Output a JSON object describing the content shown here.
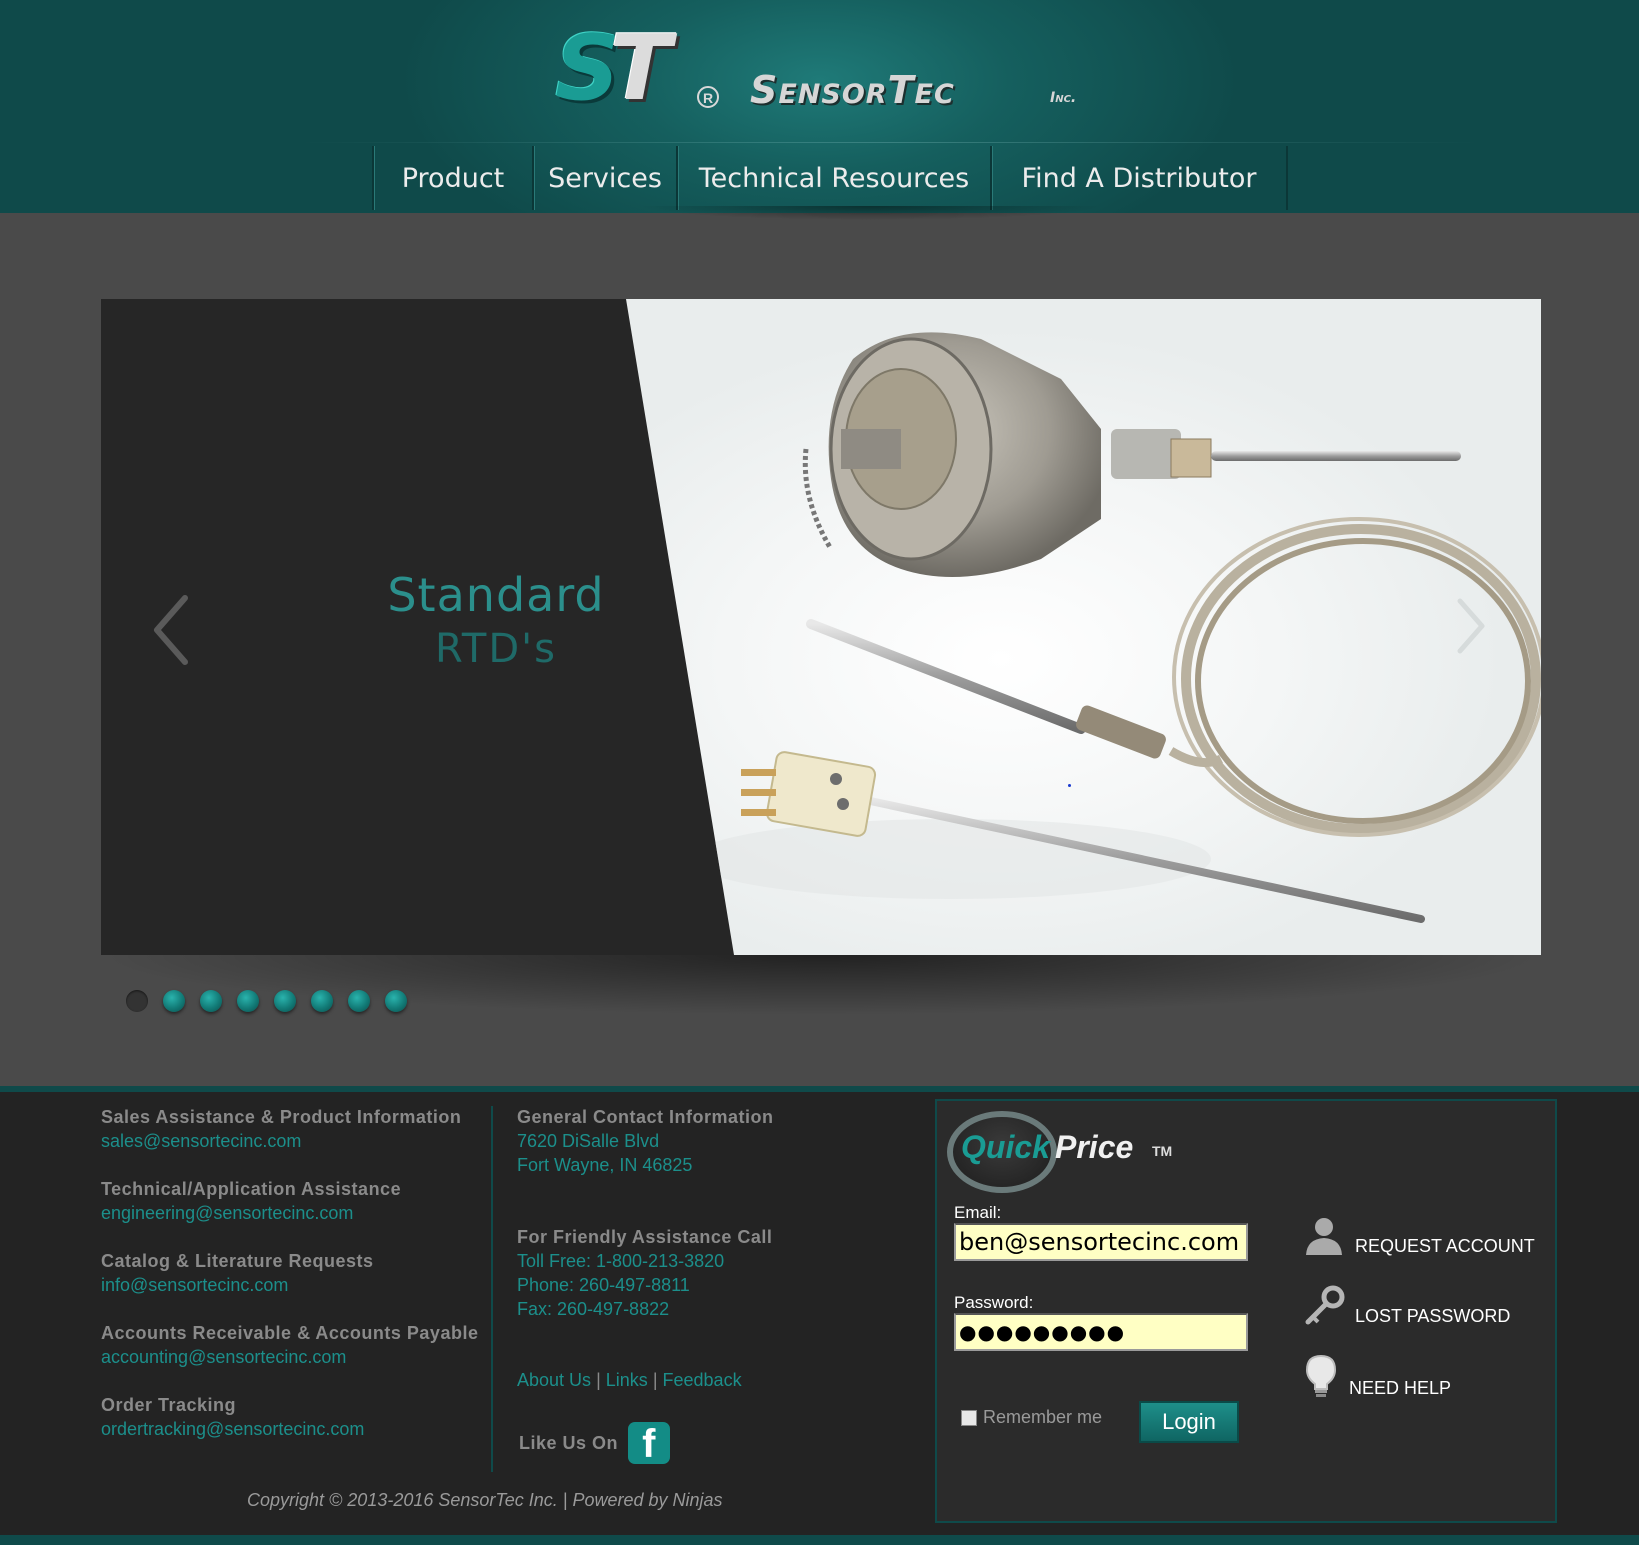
{
  "brand": {
    "logo_mark_s": "S",
    "logo_mark_t": "T",
    "logo_registered": "R",
    "company_name": "SensorTec",
    "company_suffix": "Inc."
  },
  "nav": {
    "items": [
      {
        "label": "Product"
      },
      {
        "label": "Services"
      },
      {
        "label": "Technical Resources"
      },
      {
        "label": "Find A Distributor"
      }
    ]
  },
  "slider": {
    "title": "Standard",
    "subtitle": "RTD's",
    "prev_icon": "chevron-left-icon",
    "next_icon": "chevron-right-icon",
    "slide_count": 8,
    "active_index": 0
  },
  "contact": {
    "groups": [
      {
        "label": "Sales Assistance & Product Information",
        "value": "sales@sensortecinc.com"
      },
      {
        "label": "Technical/Application Assistance",
        "value": "engineering@sensortecinc.com"
      },
      {
        "label": "Catalog & Literature Requests",
        "value": "info@sensortecinc.com"
      },
      {
        "label": "Accounts Receivable & Accounts Payable",
        "value": "accounting@sensortecinc.com"
      },
      {
        "label": "Order Tracking",
        "value": "ordertracking@sensortecinc.com"
      }
    ],
    "general": {
      "label": "General Contact Information",
      "address_line1": "7620 DiSalle Blvd",
      "address_line2": "Fort Wayne, IN 46825"
    },
    "phone": {
      "label": "For Friendly Assistance Call",
      "toll_free": "Toll Free: 1-800-213-3820",
      "phone": "Phone: 260-497-8811",
      "fax": "Fax: 260-497-8822"
    },
    "links": {
      "about": "About Us",
      "links": "Links",
      "feedback": "Feedback",
      "separator": "|"
    },
    "like_us": "Like Us On",
    "facebook_icon": "facebook-icon",
    "facebook_letter": "f"
  },
  "copyright": "Copyright © 2013-2016 SensorTec Inc. | Powered by Ninjas",
  "quickprice": {
    "logo_quick": "Quick",
    "logo_price": "Price",
    "logo_tm": "TM",
    "email_label": "Email:",
    "email_value": "ben@sensortecinc.com",
    "password_label": "Password:",
    "password_value": "●●●●●●●●●",
    "remember_label": "Remember me",
    "login_label": "Login",
    "actions": [
      {
        "label": "REQUEST ACCOUNT",
        "icon": "person-icon"
      },
      {
        "label": "LOST PASSWORD",
        "icon": "key-icon"
      },
      {
        "label": "NEED HELP",
        "icon": "lightbulb-icon"
      }
    ]
  },
  "colors": {
    "header_teal": "#155f5e",
    "accent_teal": "#1c8f8b",
    "background": "#4a4a4a",
    "footer_bg": "#232323",
    "input_bg": "#ffffc4"
  }
}
